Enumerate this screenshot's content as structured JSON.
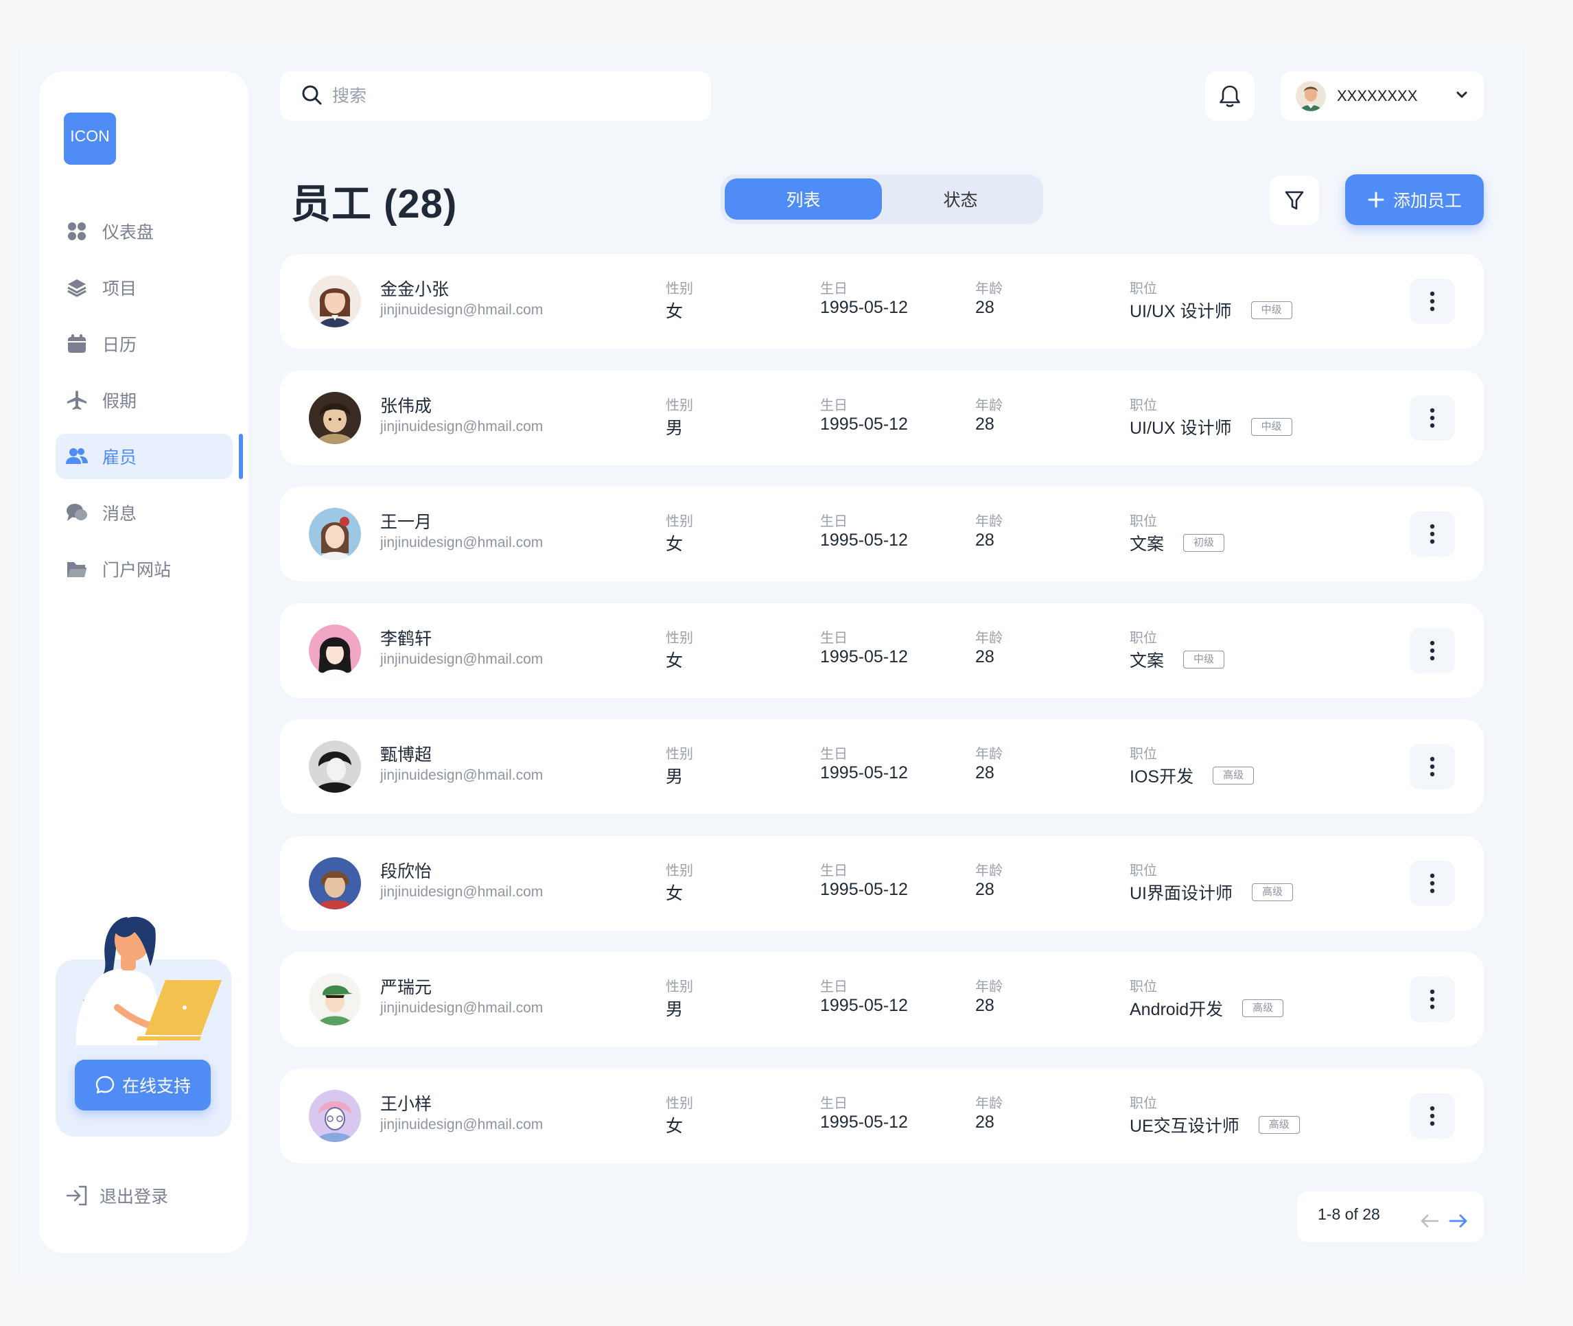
{
  "app": {
    "logo_text": "ICON"
  },
  "sidebar": {
    "items": [
      {
        "label": "仪表盘",
        "icon": "dashboard-icon",
        "active": false
      },
      {
        "label": "项目",
        "icon": "layers-icon",
        "active": false
      },
      {
        "label": "日历",
        "icon": "calendar-icon",
        "active": false
      },
      {
        "label": "假期",
        "icon": "airplane-icon",
        "active": false
      },
      {
        "label": "雇员",
        "icon": "users-icon",
        "active": true
      },
      {
        "label": "消息",
        "icon": "chat-icon",
        "active": false
      },
      {
        "label": "门户网站",
        "icon": "folder-icon",
        "active": false
      }
    ],
    "support_label": "在线支持",
    "logout_label": "退出登录"
  },
  "header": {
    "search_placeholder": "搜索",
    "username": "XXXXXXXX"
  },
  "page": {
    "title": "员工 (28)",
    "tabs": [
      {
        "label": "列表",
        "active": true
      },
      {
        "label": "状态",
        "active": false
      }
    ],
    "add_label": "添加员工"
  },
  "columns": {
    "gender": "性别",
    "birthday": "生日",
    "age": "年龄",
    "position": "职位"
  },
  "employees": [
    {
      "name": "金金小张",
      "email": "jinjinuidesign@hmail.com",
      "gender": "女",
      "birthday": "1995-05-12",
      "age": "28",
      "position": "UI/UX 设计师",
      "level": "中级"
    },
    {
      "name": "张伟成",
      "email": "jinjinuidesign@hmail.com",
      "gender": "男",
      "birthday": "1995-05-12",
      "age": "28",
      "position": "UI/UX 设计师",
      "level": "中级"
    },
    {
      "name": "王一月",
      "email": "jinjinuidesign@hmail.com",
      "gender": "女",
      "birthday": "1995-05-12",
      "age": "28",
      "position": "文案",
      "level": "初级"
    },
    {
      "name": "李鹤轩",
      "email": "jinjinuidesign@hmail.com",
      "gender": "女",
      "birthday": "1995-05-12",
      "age": "28",
      "position": "文案",
      "level": "中级"
    },
    {
      "name": "甄博超",
      "email": "jinjinuidesign@hmail.com",
      "gender": "男",
      "birthday": "1995-05-12",
      "age": "28",
      "position": "IOS开发",
      "level": "高级"
    },
    {
      "name": "段欣怡",
      "email": "jinjinuidesign@hmail.com",
      "gender": "女",
      "birthday": "1995-05-12",
      "age": "28",
      "position": "UI界面设计师",
      "level": "高级"
    },
    {
      "name": "严瑞元",
      "email": "jinjinuidesign@hmail.com",
      "gender": "男",
      "birthday": "1995-05-12",
      "age": "28",
      "position": "Android开发",
      "level": "高级"
    },
    {
      "name": "王小样",
      "email": "jinjinuidesign@hmail.com",
      "gender": "女",
      "birthday": "1995-05-12",
      "age": "28",
      "position": "UE交互设计师",
      "level": "高级"
    }
  ],
  "pagination": {
    "text": "1-8 of 28"
  },
  "colors": {
    "accent": "#4f8cf5",
    "accent_light": "#e8effd",
    "background": "#f3f6fb"
  }
}
